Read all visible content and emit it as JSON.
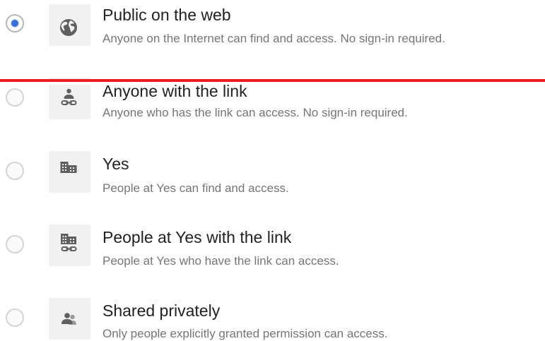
{
  "options": [
    {
      "title": "Public on the web",
      "description": "Anyone on the Internet can find and access. No sign-in required.",
      "icon": "globe-icon",
      "selected": true
    },
    {
      "title": "Anyone with the link",
      "description": "Anyone who has the link can access. No sign-in required.",
      "icon": "person-link-icon",
      "selected": false
    },
    {
      "title": "Yes",
      "description": "People at Yes can find and access.",
      "icon": "building-icon",
      "selected": false
    },
    {
      "title": "People at Yes with the link",
      "description": "People at Yes who have the link can access.",
      "icon": "building-link-icon",
      "selected": false
    },
    {
      "title": "Shared privately",
      "description": "Only people explicitly granted permission can access.",
      "icon": "people-icon",
      "selected": false
    }
  ],
  "colors": {
    "radio_selected": "#3b6fd6",
    "divider": "#ec1c24",
    "icon_fill": "#5f5f5f"
  }
}
